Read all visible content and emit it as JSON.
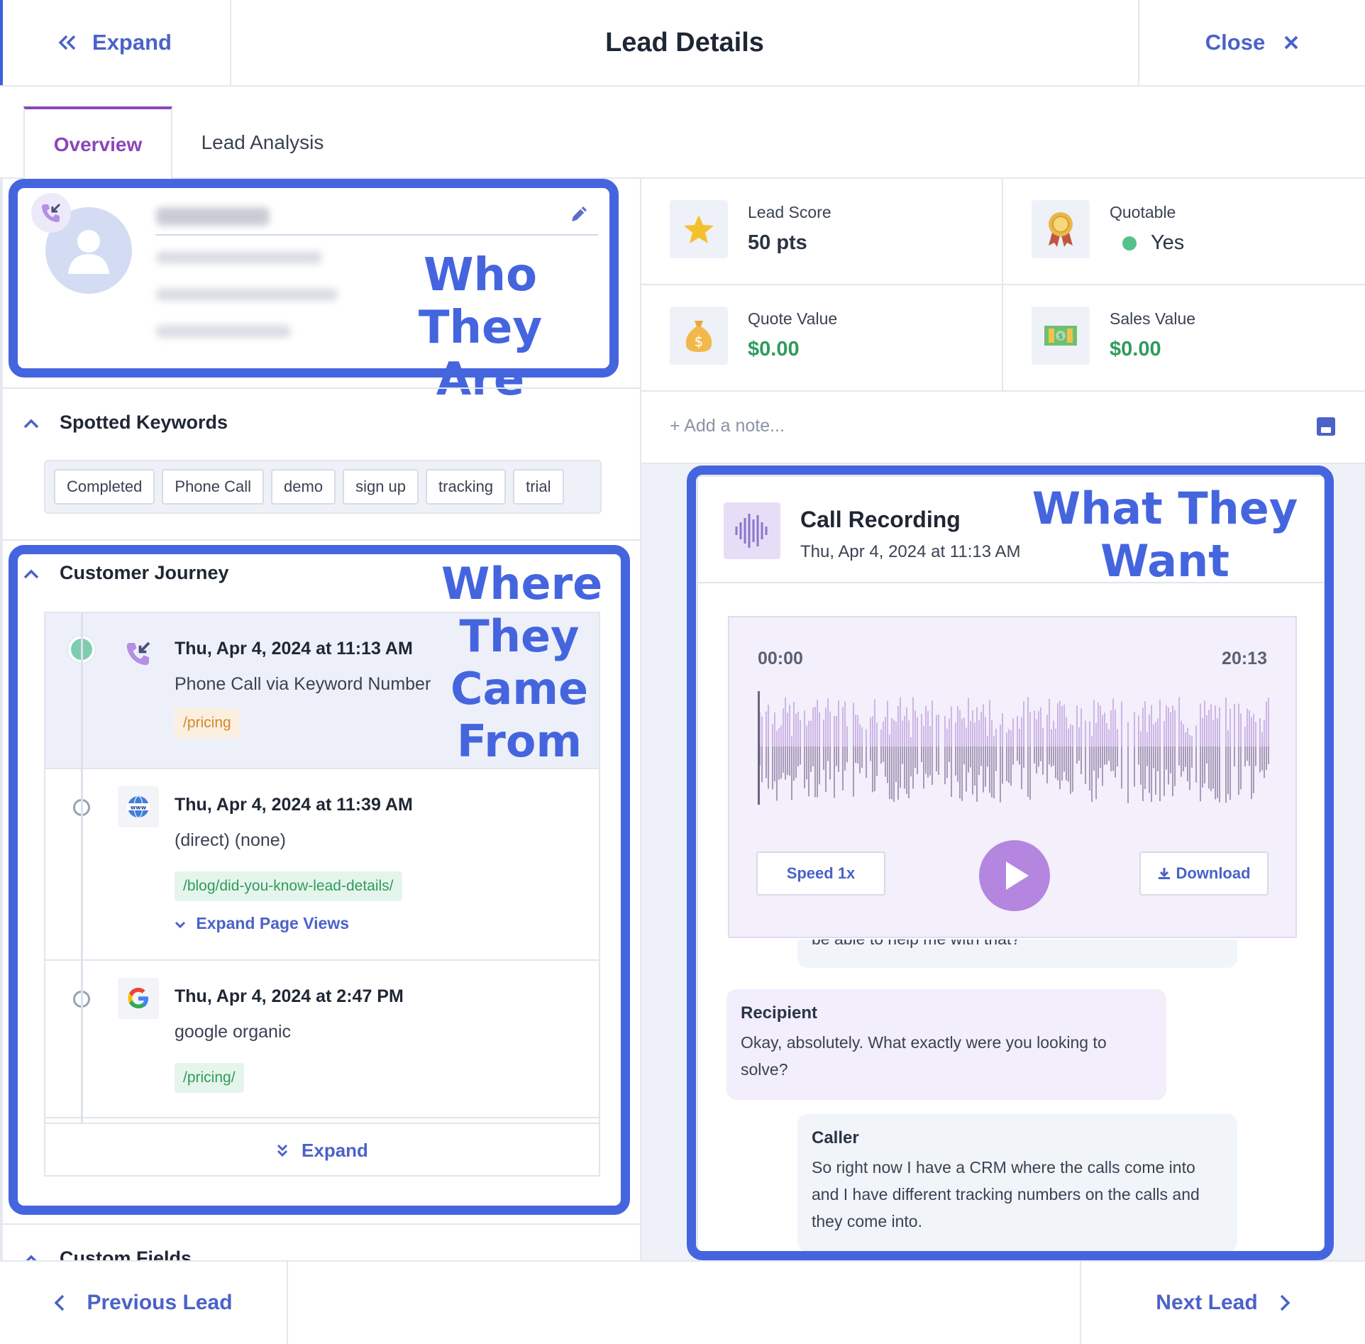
{
  "header": {
    "expand_label": "Expand",
    "title": "Lead Details",
    "close_label": "Close"
  },
  "tabs": [
    {
      "label": "Overview",
      "active": true
    },
    {
      "label": "Lead Analysis",
      "active": false
    }
  ],
  "annotations": {
    "who_line1": "Who They",
    "who_line2": "Are",
    "where_line1": "Where",
    "where_line2": "They",
    "where_line3": "Came",
    "where_line4": "From",
    "what_line1": "What They",
    "what_line2": "Want"
  },
  "spotted_keywords": {
    "title": "Spotted Keywords",
    "keywords": [
      "Completed",
      "Phone Call",
      "demo",
      "sign up",
      "tracking",
      "trial"
    ]
  },
  "customer_journey": {
    "title": "Customer Journey",
    "entries": [
      {
        "date": "Thu, Apr 4, 2024 at 11:13 AM",
        "source": "Phone Call via Keyword Number",
        "page": "/pricing",
        "icon": "phone-incoming-icon"
      },
      {
        "date": "Thu, Apr 4, 2024 at 11:39 AM",
        "source": "(direct) (none)",
        "page": "/blog/did-you-know-lead-details/",
        "expand_label": "Expand Page Views",
        "icon": "www-globe-icon"
      },
      {
        "date": "Thu, Apr 4, 2024 at 2:47 PM",
        "source": "google organic",
        "page": "/pricing/",
        "icon": "google-icon"
      }
    ],
    "expand_label": "Expand"
  },
  "custom_fields_title": "Custom Fields",
  "stats": {
    "lead_score": {
      "label": "Lead Score",
      "value": "50 pts",
      "icon": "star-icon"
    },
    "quotable": {
      "label": "Quotable",
      "value": "Yes",
      "icon": "award-ribbon-icon"
    },
    "quote_value": {
      "label": "Quote Value",
      "value": "$0.00",
      "icon": "money-bag-icon"
    },
    "sales_value": {
      "label": "Sales Value",
      "value": "$0.00",
      "icon": "cash-icon"
    }
  },
  "note": {
    "placeholder": "+ Add a note..."
  },
  "recording": {
    "title": "Call Recording",
    "date": "Thu, Apr 4, 2024 at 11:13 AM",
    "time_start": "00:00",
    "time_end": "20:13",
    "speed_label": "Speed 1x",
    "download_label": "Download",
    "transcript": [
      {
        "speaker": "",
        "text": "be able to help me with that?"
      },
      {
        "speaker": "Recipient",
        "text": "Okay, absolutely. What exactly were you looking to solve?"
      },
      {
        "speaker": "Caller",
        "text": "So right now I have a CRM where the calls come into and I have different tracking numbers on the calls and they come into."
      }
    ]
  },
  "footer": {
    "previous_label": "Previous Lead",
    "next_label": "Next Lead"
  },
  "colors": {
    "accent": "#4b62c9",
    "annotation": "#4565df",
    "tab_active": "#8b46b8",
    "money": "#2f9b5d"
  }
}
